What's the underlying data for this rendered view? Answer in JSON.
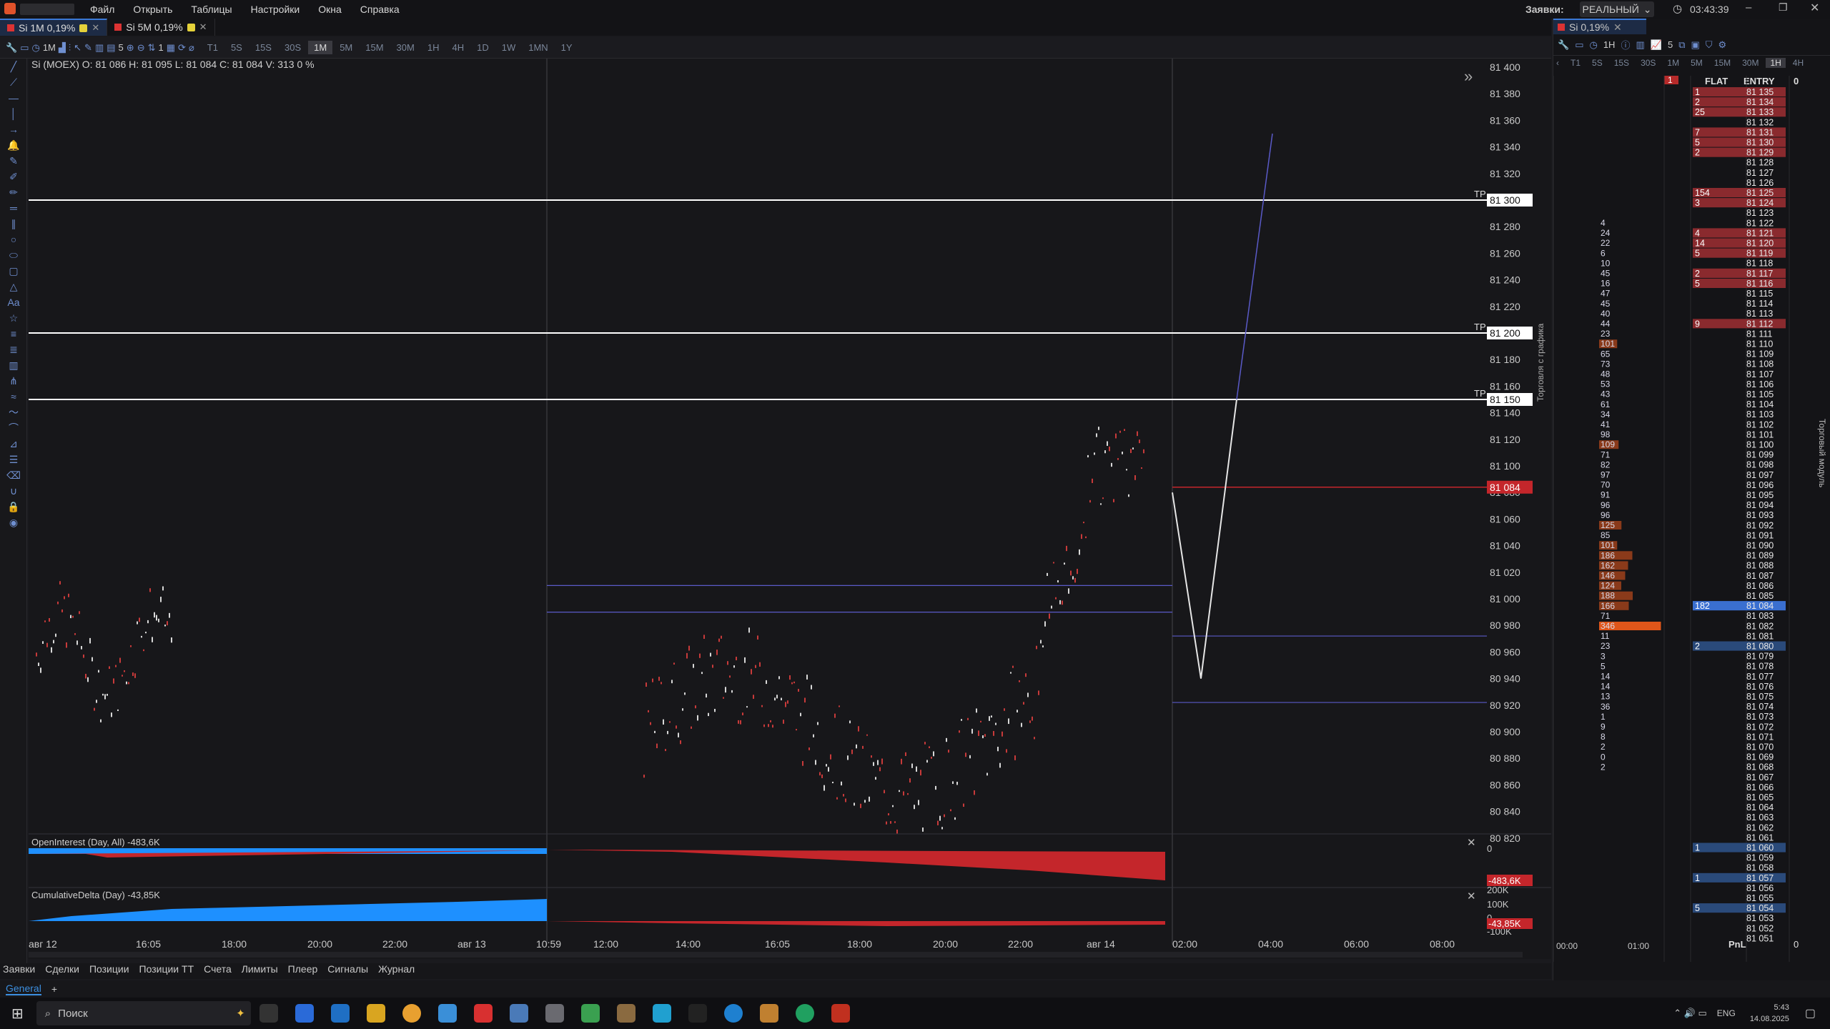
{
  "titlebar": {
    "menu": [
      "Файл",
      "Открыть",
      "Таблицы",
      "Настройки",
      "Окна",
      "Справка"
    ],
    "orders_label": "Заявки:",
    "mode": "РЕАЛЬНЫЙ",
    "clock": "03:43:39"
  },
  "tabs": [
    {
      "label": "Si 1M 0,19%",
      "active": true
    },
    {
      "label": "Si 5M 0,19%",
      "active": false
    }
  ],
  "right_tab": {
    "label": "Si 0,19%"
  },
  "toolbar": {
    "timeframe": "1M",
    "count": "5",
    "tick": "1",
    "timeframes": [
      "T1",
      "5S",
      "15S",
      "30S",
      "1M",
      "5M",
      "15M",
      "30M",
      "1H",
      "4H",
      "1D",
      "1W",
      "1MN",
      "1Y"
    ],
    "selected_timeframe": "1M"
  },
  "chart": {
    "legend": "Si (MOEX) O: 81 086 H: 81 095 L: 81 084 C: 81 084 V: 313 0 %",
    "price_ticks": [
      "81 400",
      "81 380",
      "81 360",
      "81 340",
      "81 320",
      "81 300",
      "81 280",
      "81 260",
      "81 240",
      "81 220",
      "81 200",
      "81 180",
      "81 160",
      "81 140",
      "81 120",
      "81 100",
      "81 080",
      "81 060",
      "81 040",
      "81 020",
      "81 000",
      "80 980",
      "80 960",
      "80 940",
      "80 920",
      "80 900",
      "80 880",
      "80 860",
      "80 840",
      "80 820"
    ],
    "tp_lines": [
      {
        "label": "TP",
        "price": "81 300"
      },
      {
        "label": "TP",
        "price": "81 200"
      },
      {
        "label": "TP",
        "price": "81 150"
      }
    ],
    "last_price": "81 084",
    "time_ticks": [
      "авг 12",
      "16:05",
      "18:00",
      "20:00",
      "22:00",
      "авг 13",
      "10:59",
      "12:00",
      "14:00",
      "16:05",
      "18:00",
      "20:00",
      "22:00",
      "авг 14",
      "02:00",
      "04:00",
      "06:00",
      "08:00"
    ],
    "oi_panel": {
      "label": "OpenInterest (Day, All)",
      "value": "-483,6K",
      "axis": [
        "0"
      ],
      "badge": "-483,6K"
    },
    "cd_panel": {
      "label": "CumulativeDelta (Day)",
      "value": "-43,85K",
      "axis": [
        "200K",
        "100K",
        "0",
        "-100K"
      ],
      "badge": "-43,85K"
    },
    "side_label": "Торговля с графика"
  },
  "bottom_tabs": [
    "Заявки",
    "Сделки",
    "Позиции",
    "Позиции ТТ",
    "Счета",
    "Лимиты",
    "Плеер",
    "Сигналы",
    "Журнал"
  ],
  "workspace": {
    "label": "General",
    "add": "+"
  },
  "dom": {
    "timeframes": [
      "T1",
      "5S",
      "15S",
      "30S",
      "1M",
      "5M",
      "15M",
      "30M",
      "1H",
      "4H"
    ],
    "toolbar_tf": "1H",
    "toolbar_count": "5",
    "headers": {
      "flat": "FLAT",
      "entry": "ENTRY",
      "zero": "0"
    },
    "position": "1",
    "side_label": "Торговый модуль",
    "time_ticks": [
      "00:00",
      "01:00"
    ],
    "pnl_label": "PnL",
    "pnl_value": "0",
    "prices": [
      "81 135",
      "81 134",
      "81 133",
      "81 132",
      "81 131",
      "81 130",
      "81 129",
      "81 128",
      "81 127",
      "81 126",
      "81 125",
      "81 124",
      "81 123",
      "81 122",
      "81 121",
      "81 120",
      "81 119",
      "81 118",
      "81 117",
      "81 116",
      "81 115",
      "81 114",
      "81 113",
      "81 112",
      "81 111",
      "81 110",
      "81 109",
      "81 108",
      "81 107",
      "81 106",
      "81 105",
      "81 104",
      "81 103",
      "81 102",
      "81 101",
      "81 100",
      "81 099",
      "81 098",
      "81 097",
      "81 096",
      "81 095",
      "81 094",
      "81 093",
      "81 092",
      "81 091",
      "81 090",
      "81 089",
      "81 088",
      "81 087",
      "81 086",
      "81 085",
      "81 084",
      "81 083",
      "81 082",
      "81 081",
      "81 080",
      "81 079",
      "81 078",
      "81 077",
      "81 076",
      "81 075",
      "81 074",
      "81 073",
      "81 072",
      "81 071",
      "81 070",
      "81 069",
      "81 068",
      "81 067",
      "81 066",
      "81 065",
      "81 064",
      "81 063",
      "81 062",
      "81 061",
      "81 060",
      "81 059",
      "81 058",
      "81 057",
      "81 056",
      "81 055",
      "81 054",
      "81 053",
      "81 052",
      "81 051"
    ],
    "asks": [
      [
        "1",
        "81 135"
      ],
      [
        "2",
        "81 134"
      ],
      [
        "25",
        "81 133"
      ],
      [
        "7",
        "81 131"
      ],
      [
        "5",
        "81 130"
      ],
      [
        "2",
        "81 129"
      ],
      [
        "154",
        "81 125"
      ],
      [
        "3",
        "81 124"
      ],
      [
        "4",
        "81 121"
      ],
      [
        "14",
        "81 120"
      ],
      [
        "5",
        "81 119"
      ],
      [
        "2",
        "81 117"
      ],
      [
        "5",
        "81 116"
      ],
      [
        "9",
        "81 112"
      ]
    ],
    "bids": [
      [
        "182",
        "81 084"
      ],
      [
        "2",
        "81 080"
      ],
      [
        "1",
        "81 060"
      ],
      [
        "1",
        "81 057"
      ],
      [
        "5",
        "81 054"
      ]
    ],
    "volumes": [
      "4",
      "24",
      "22",
      "6",
      "10",
      "45",
      "16",
      "47",
      "45",
      "40",
      "44",
      "23",
      "101",
      "65",
      "73",
      "48",
      "53",
      "43",
      "61",
      "34",
      "41",
      "98",
      "109",
      "71",
      "82",
      "97",
      "70",
      "91",
      "96",
      "96",
      "125",
      "85",
      "101",
      "186",
      "162",
      "146",
      "124",
      "188",
      "166",
      "71",
      "346",
      "11",
      "23",
      "3",
      "5",
      "14",
      "14",
      "13",
      "36",
      "1",
      "9",
      "8",
      "2",
      "0",
      "2"
    ]
  },
  "taskbar": {
    "search": "Поиск",
    "lang": "ENG",
    "time": "5:43",
    "date": "14.08.2025"
  },
  "colors": {
    "accent": "#2f6fd8",
    "ask": "#8a2a2e",
    "bid": "#2a4a7a",
    "oi_up": "#1e90ff",
    "oi_down": "#c4262b",
    "last": "#c4262b"
  }
}
